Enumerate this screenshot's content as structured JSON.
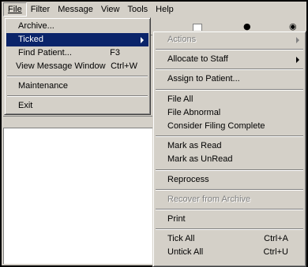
{
  "menubar": {
    "items": [
      {
        "label": "File"
      },
      {
        "label": "Filter"
      },
      {
        "label": "Message"
      },
      {
        "label": "View"
      },
      {
        "label": "Tools"
      },
      {
        "label": "Help"
      }
    ]
  },
  "file_menu": {
    "items": [
      {
        "label": "Archive...",
        "shortcut": ""
      },
      {
        "label": "Ticked",
        "shortcut": ""
      },
      {
        "label": "Find Patient...",
        "shortcut": "F3"
      },
      {
        "label": "View Message Window",
        "shortcut": "Ctrl+W"
      },
      {
        "label": "Maintenance",
        "shortcut": ""
      },
      {
        "label": "Exit",
        "shortcut": ""
      }
    ]
  },
  "ticked_submenu": {
    "items": [
      {
        "label": "Actions",
        "shortcut": ""
      },
      {
        "label": "Allocate to Staff",
        "shortcut": ""
      },
      {
        "label": "Assign to Patient...",
        "shortcut": ""
      },
      {
        "label": "File All",
        "shortcut": ""
      },
      {
        "label": "File Abnormal",
        "shortcut": ""
      },
      {
        "label": "Consider Filing Complete",
        "shortcut": ""
      },
      {
        "label": "Mark as Read",
        "shortcut": ""
      },
      {
        "label": "Mark as UnRead",
        "shortcut": ""
      },
      {
        "label": "Reprocess",
        "shortcut": ""
      },
      {
        "label": "Recover from Archive",
        "shortcut": ""
      },
      {
        "label": "Print",
        "shortcut": ""
      },
      {
        "label": "Tick All",
        "shortcut": "Ctrl+A"
      },
      {
        "label": "Untick All",
        "shortcut": "Ctrl+U"
      }
    ]
  },
  "toolbar": {
    "icons": [
      "checkbox-icon",
      "person-icon",
      "person-group-icon"
    ]
  }
}
